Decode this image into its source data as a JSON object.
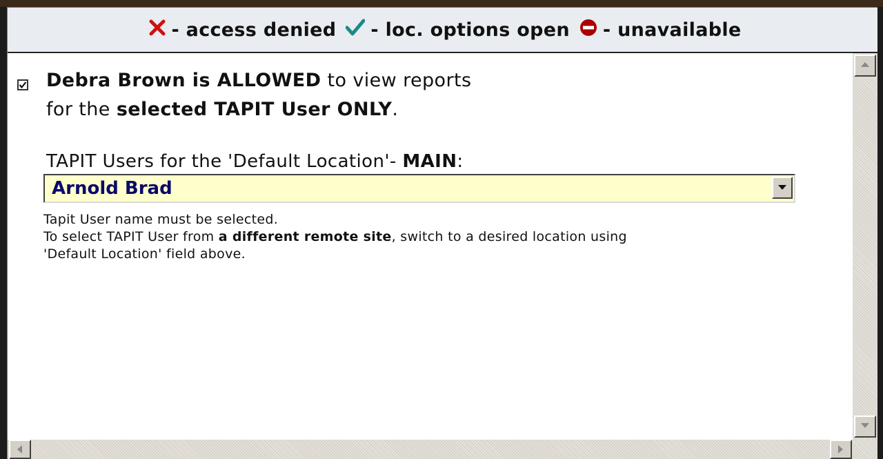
{
  "legend": {
    "denied_text": "- access denied",
    "open_text": "- loc. options open",
    "unavailable_text": "- unavailable",
    "denied_icon": "x-icon",
    "open_icon": "checkmark-icon",
    "unavailable_icon": "no-entry-icon",
    "colors": {
      "denied": "#cc1111",
      "open": "#1a8a8a",
      "unavailable": "#aa0000"
    }
  },
  "permission": {
    "checked": true,
    "user_name_part": "Debra Brown is ALLOWED",
    "line1_rest": " to view reports",
    "line2_prefix": "for the ",
    "line2_bold": "selected TAPIT User ONLY",
    "line2_suffix": "."
  },
  "location": {
    "label_prefix": "TAPIT Users for the 'Default Location'- ",
    "label_bold": "MAIN",
    "label_suffix": ":"
  },
  "user_select": {
    "selected_value": "Arnold Brad"
  },
  "hint": {
    "line1": "Tapit User name must be selected.",
    "line2_prefix": "To select TAPIT User from ",
    "line2_bold": "a different remote site",
    "line2_suffix": ", switch to a desired location using",
    "line3": "'Default Location' field above."
  }
}
